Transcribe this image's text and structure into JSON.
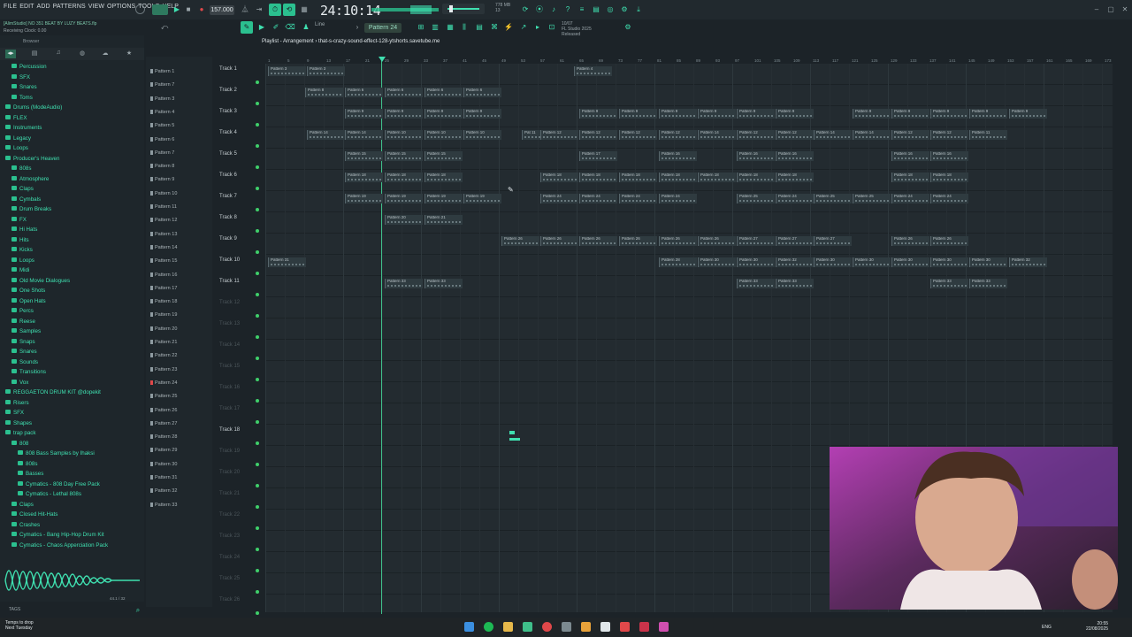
{
  "menu": [
    "FILE",
    "EDIT",
    "ADD",
    "PATTERNS",
    "VIEW",
    "OPTIONS",
    "TOOLS",
    "HELP"
  ],
  "project_title": "[AlimStudio] NO 351 BEAT BY LUZY BEATS.flp",
  "clock_status": "Receiving Clock: 0.00",
  "tempo": "157.000",
  "song_position": "24:10:14",
  "memory": {
    "mem": "778 MB",
    "cpu": "13"
  },
  "fl_version": {
    "date": "10/07",
    "name": "FL Studio 2025",
    "status": "Released"
  },
  "pattern_selector": "Pattern 24",
  "snap_mode": "Line",
  "playlist_title": "Playlist - Arrangement › that-s-crazy-sound-effect-128-ytshorts.savetube.me",
  "browser": {
    "label": "Browser",
    "items": [
      {
        "label": "Percussion",
        "indent": 1
      },
      {
        "label": "SFX",
        "indent": 1
      },
      {
        "label": "Snares",
        "indent": 1
      },
      {
        "label": "Toms",
        "indent": 1
      },
      {
        "label": "Drums (ModeAudio)",
        "indent": 0
      },
      {
        "label": "FLEX",
        "indent": 0
      },
      {
        "label": "Instruments",
        "indent": 0
      },
      {
        "label": "Legacy",
        "indent": 0
      },
      {
        "label": "Loops",
        "indent": 0
      },
      {
        "label": "Producer's Heaven",
        "indent": 0
      },
      {
        "label": "808s",
        "indent": 1
      },
      {
        "label": "Atmosphere",
        "indent": 1
      },
      {
        "label": "Claps",
        "indent": 1
      },
      {
        "label": "Cymbals",
        "indent": 1
      },
      {
        "label": "Drum Breaks",
        "indent": 1
      },
      {
        "label": "FX",
        "indent": 1
      },
      {
        "label": "Hi Hats",
        "indent": 1
      },
      {
        "label": "Hits",
        "indent": 1
      },
      {
        "label": "Kicks",
        "indent": 1
      },
      {
        "label": "Loops",
        "indent": 1
      },
      {
        "label": "Midi",
        "indent": 1
      },
      {
        "label": "Old Movie Dialogues",
        "indent": 1
      },
      {
        "label": "One Shots",
        "indent": 1
      },
      {
        "label": "Open Hats",
        "indent": 1
      },
      {
        "label": "Percs",
        "indent": 1
      },
      {
        "label": "Reese",
        "indent": 1
      },
      {
        "label": "Samples",
        "indent": 1
      },
      {
        "label": "Snaps",
        "indent": 1
      },
      {
        "label": "Snares",
        "indent": 1
      },
      {
        "label": "Sounds",
        "indent": 1
      },
      {
        "label": "Transitions",
        "indent": 1
      },
      {
        "label": "Vox",
        "indent": 1
      },
      {
        "label": "REGGAETON DRUM KIT @dopekit",
        "indent": 0
      },
      {
        "label": "Risers",
        "indent": 0
      },
      {
        "label": "SFX",
        "indent": 0
      },
      {
        "label": "Shapes",
        "indent": 0
      },
      {
        "label": "trap pack",
        "indent": 0
      },
      {
        "label": "808",
        "indent": 1
      },
      {
        "label": "808 Bass Samples by Ihaksi",
        "indent": 2
      },
      {
        "label": "808s",
        "indent": 2
      },
      {
        "label": "Basses",
        "indent": 2
      },
      {
        "label": "Cymatics - 808 Day Free Pack",
        "indent": 2
      },
      {
        "label": "Cymatics - Lethal 808s",
        "indent": 2
      },
      {
        "label": "Claps",
        "indent": 1
      },
      {
        "label": "Closed Hit-Hats",
        "indent": 1
      },
      {
        "label": "Crashes",
        "indent": 1
      },
      {
        "label": "Cymatics - Bang Hip-Hop Drum Kit",
        "indent": 1
      },
      {
        "label": "Cymatics - Chaos Apperciation Pack",
        "indent": 1
      }
    ],
    "tags_label": "TAGS",
    "wave_info": "44.1 / 32"
  },
  "patterns": [
    "Pattern 1",
    "Pattern 7",
    "Pattern 3",
    "Pattern 4",
    "Pattern 5",
    "Pattern 6",
    "Pattern 7",
    "Pattern 8",
    "Pattern 9",
    "Pattern 10",
    "Pattern 11",
    "Pattern 12",
    "Pattern 13",
    "Pattern 14",
    "Pattern 15",
    "Pattern 16",
    "Pattern 17",
    "Pattern 18",
    "Pattern 19",
    "Pattern 20",
    "Pattern 21",
    "Pattern 22",
    "Pattern 23",
    "Pattern 24",
    "Pattern 25",
    "Pattern 26",
    "Pattern 27",
    "Pattern 28",
    "Pattern 29",
    "Pattern 30",
    "Pattern 31",
    "Pattern 32",
    "Pattern 33"
  ],
  "tracks": [
    "Track 1",
    "Track 2",
    "Track 3",
    "Track 4",
    "Track 5",
    "Track 6",
    "Track 7",
    "Track 8",
    "Track 9",
    "Track 10",
    "Track 11",
    "Track 12",
    "Track 13",
    "Track 14",
    "Track 15",
    "Track 16",
    "Track 17",
    "Track 18",
    "Track 19",
    "Track 20",
    "Track 21",
    "Track 22",
    "Track 23",
    "Track 24",
    "Track 25",
    "Track 26"
  ],
  "ruler": [
    "1",
    "5",
    "9",
    "13",
    "17",
    "21",
    "25",
    "29",
    "33",
    "37",
    "41",
    "45",
    "49",
    "53",
    "57",
    "61",
    "65",
    "69",
    "73",
    "77",
    "81",
    "85",
    "89",
    "93",
    "97",
    "101",
    "105",
    "109",
    "113",
    "117",
    "121",
    "125",
    "129",
    "133",
    "137",
    "141",
    "145",
    "149",
    "153",
    "157",
    "161",
    "165",
    "169",
    "173"
  ],
  "clips": [
    {
      "track": 0,
      "bar": 3,
      "label": "Pattern 3"
    },
    {
      "track": 0,
      "bar": 47,
      "label": "Pattern 3"
    },
    {
      "track": 0,
      "bar": 349,
      "label": "Pattern 4"
    },
    {
      "track": 1,
      "bar": 45,
      "label": "Pattern 8"
    },
    {
      "track": 1,
      "bar": 90,
      "label": "Pattern 6"
    },
    {
      "track": 1,
      "bar": 135,
      "label": "Pattern 6"
    },
    {
      "track": 1,
      "bar": 180,
      "label": "Pattern 6"
    },
    {
      "track": 1,
      "bar": 224,
      "label": "Pattern 6"
    },
    {
      "track": 2,
      "bar": 90,
      "label": "Pattern 9"
    },
    {
      "track": 2,
      "bar": 135,
      "label": "Pattern 9"
    },
    {
      "track": 2,
      "bar": 180,
      "label": "Pattern 9"
    },
    {
      "track": 2,
      "bar": 224,
      "label": "Pattern 9"
    },
    {
      "track": 2,
      "bar": 355,
      "label": "Pattern 9"
    },
    {
      "track": 2,
      "bar": 400,
      "label": "Pattern 9"
    },
    {
      "track": 2,
      "bar": 445,
      "label": "Pattern 9"
    },
    {
      "track": 2,
      "bar": 489,
      "label": "Pattern 9"
    },
    {
      "track": 2,
      "bar": 533,
      "label": "Pattern 9"
    },
    {
      "track": 2,
      "bar": 577,
      "label": "Pattern 9"
    },
    {
      "track": 2,
      "bar": 664,
      "label": "Pattern 9"
    },
    {
      "track": 2,
      "bar": 708,
      "label": "Pattern 9"
    },
    {
      "track": 2,
      "bar": 752,
      "label": "Pattern 9"
    },
    {
      "track": 2,
      "bar": 796,
      "label": "Pattern 9"
    },
    {
      "track": 2,
      "bar": 841,
      "label": "Pattern 9"
    },
    {
      "track": 3,
      "bar": 47,
      "label": "Pattern 14"
    },
    {
      "track": 3,
      "bar": 90,
      "label": "Pattern 14"
    },
    {
      "track": 3,
      "bar": 135,
      "label": "Pattern 10"
    },
    {
      "track": 3,
      "bar": 180,
      "label": "Pattern 10"
    },
    {
      "track": 3,
      "bar": 224,
      "label": "Pattern 10"
    },
    {
      "track": 3,
      "bar": 290,
      "label": "Pat 11"
    },
    {
      "track": 3,
      "bar": 311,
      "label": "Pattern 12"
    },
    {
      "track": 3,
      "bar": 355,
      "label": "Pattern 12"
    },
    {
      "track": 3,
      "bar": 400,
      "label": "Pattern 12"
    },
    {
      "track": 3,
      "bar": 445,
      "label": "Pattern 12"
    },
    {
      "track": 3,
      "bar": 489,
      "label": "Pattern 14"
    },
    {
      "track": 3,
      "bar": 533,
      "label": "Pattern 12"
    },
    {
      "track": 3,
      "bar": 577,
      "label": "Pattern 12"
    },
    {
      "track": 3,
      "bar": 620,
      "label": "Pattern 14"
    },
    {
      "track": 3,
      "bar": 664,
      "label": "Pattern 14"
    },
    {
      "track": 3,
      "bar": 708,
      "label": "Pattern 12"
    },
    {
      "track": 3,
      "bar": 752,
      "label": "Pattern 12"
    },
    {
      "track": 3,
      "bar": 796,
      "label": "Pattern 11"
    },
    {
      "track": 4,
      "bar": 90,
      "label": "Pattern 15"
    },
    {
      "track": 4,
      "bar": 135,
      "label": "Pattern 15"
    },
    {
      "track": 4,
      "bar": 180,
      "label": "Pattern 15"
    },
    {
      "track": 4,
      "bar": 355,
      "label": "Pattern 17"
    },
    {
      "track": 4,
      "bar": 445,
      "label": "Pattern 16"
    },
    {
      "track": 4,
      "bar": 533,
      "label": "Pattern 16"
    },
    {
      "track": 4,
      "bar": 577,
      "label": "Pattern 16"
    },
    {
      "track": 4,
      "bar": 708,
      "label": "Pattern 16"
    },
    {
      "track": 4,
      "bar": 752,
      "label": "Pattern 16"
    },
    {
      "track": 5,
      "bar": 90,
      "label": "Pattern 18"
    },
    {
      "track": 5,
      "bar": 135,
      "label": "Pattern 18"
    },
    {
      "track": 5,
      "bar": 180,
      "label": "Pattern 18"
    },
    {
      "track": 5,
      "bar": 311,
      "label": "Pattern 18"
    },
    {
      "track": 5,
      "bar": 355,
      "label": "Pattern 18"
    },
    {
      "track": 5,
      "bar": 400,
      "label": "Pattern 18"
    },
    {
      "track": 5,
      "bar": 445,
      "label": "Pattern 18"
    },
    {
      "track": 5,
      "bar": 489,
      "label": "Pattern 18"
    },
    {
      "track": 5,
      "bar": 533,
      "label": "Pattern 18"
    },
    {
      "track": 5,
      "bar": 577,
      "label": "Pattern 18"
    },
    {
      "track": 5,
      "bar": 708,
      "label": "Pattern 18"
    },
    {
      "track": 5,
      "bar": 752,
      "label": "Pattern 18"
    },
    {
      "track": 6,
      "bar": 90,
      "label": "Pattern 19"
    },
    {
      "track": 6,
      "bar": 135,
      "label": "Pattern 19"
    },
    {
      "track": 6,
      "bar": 180,
      "label": "Pattern 19"
    },
    {
      "track": 6,
      "bar": 224,
      "label": "Pattern 19"
    },
    {
      "track": 6,
      "bar": 311,
      "label": "Pattern 24"
    },
    {
      "track": 6,
      "bar": 355,
      "label": "Pattern 24"
    },
    {
      "track": 6,
      "bar": 400,
      "label": "Pattern 24"
    },
    {
      "track": 6,
      "bar": 445,
      "label": "Pattern 24"
    },
    {
      "track": 6,
      "bar": 533,
      "label": "Pattern 25"
    },
    {
      "track": 6,
      "bar": 577,
      "label": "Pattern 24"
    },
    {
      "track": 6,
      "bar": 620,
      "label": "Pattern 25"
    },
    {
      "track": 6,
      "bar": 664,
      "label": "Pattern 25"
    },
    {
      "track": 6,
      "bar": 708,
      "label": "Pattern 24"
    },
    {
      "track": 6,
      "bar": 752,
      "label": "Pattern 24"
    },
    {
      "track": 7,
      "bar": 135,
      "label": "Pattern 20"
    },
    {
      "track": 7,
      "bar": 180,
      "label": "Pattern 21"
    },
    {
      "track": 8,
      "bar": 267,
      "label": "Pattern 26"
    },
    {
      "track": 8,
      "bar": 311,
      "label": "Pattern 26"
    },
    {
      "track": 8,
      "bar": 355,
      "label": "Pattern 26"
    },
    {
      "track": 8,
      "bar": 400,
      "label": "Pattern 26"
    },
    {
      "track": 8,
      "bar": 445,
      "label": "Pattern 26"
    },
    {
      "track": 8,
      "bar": 489,
      "label": "Pattern 26"
    },
    {
      "track": 8,
      "bar": 533,
      "label": "Pattern 27"
    },
    {
      "track": 8,
      "bar": 577,
      "label": "Pattern 27"
    },
    {
      "track": 8,
      "bar": 620,
      "label": "Pattern 27"
    },
    {
      "track": 8,
      "bar": 708,
      "label": "Pattern 26"
    },
    {
      "track": 8,
      "bar": 752,
      "label": "Pattern 26"
    },
    {
      "track": 9,
      "bar": 3,
      "label": "Pattern 31"
    },
    {
      "track": 9,
      "bar": 445,
      "label": "Pattern 28"
    },
    {
      "track": 9,
      "bar": 489,
      "label": "Pattern 30"
    },
    {
      "track": 9,
      "bar": 533,
      "label": "Pattern 30"
    },
    {
      "track": 9,
      "bar": 577,
      "label": "Pattern 32"
    },
    {
      "track": 9,
      "bar": 620,
      "label": "Pattern 30"
    },
    {
      "track": 9,
      "bar": 664,
      "label": "Pattern 30"
    },
    {
      "track": 9,
      "bar": 708,
      "label": "Pattern 30"
    },
    {
      "track": 9,
      "bar": 752,
      "label": "Pattern 30"
    },
    {
      "track": 9,
      "bar": 796,
      "label": "Pattern 30"
    },
    {
      "track": 9,
      "bar": 841,
      "label": "Pattern 32"
    },
    {
      "track": 10,
      "bar": 135,
      "label": "Pattern 33"
    },
    {
      "track": 10,
      "bar": 180,
      "label": "Pattern 33"
    },
    {
      "track": 10,
      "bar": 533,
      "label": "Pattern 33"
    },
    {
      "track": 10,
      "bar": 577,
      "label": "Pattern 33"
    },
    {
      "track": 10,
      "bar": 752,
      "label": "Pattern 33"
    },
    {
      "track": 10,
      "bar": 796,
      "label": "Pattern 33"
    }
  ],
  "taskbar": {
    "weather": "Temps to drop",
    "weather_sub": "Next Tuesday",
    "lang": "ENG",
    "time": "20:55",
    "date": "22/08/2025"
  },
  "colors": {
    "accent": "#3fe0b0",
    "playhead": "#3fbf8a",
    "background": "#232b30"
  }
}
